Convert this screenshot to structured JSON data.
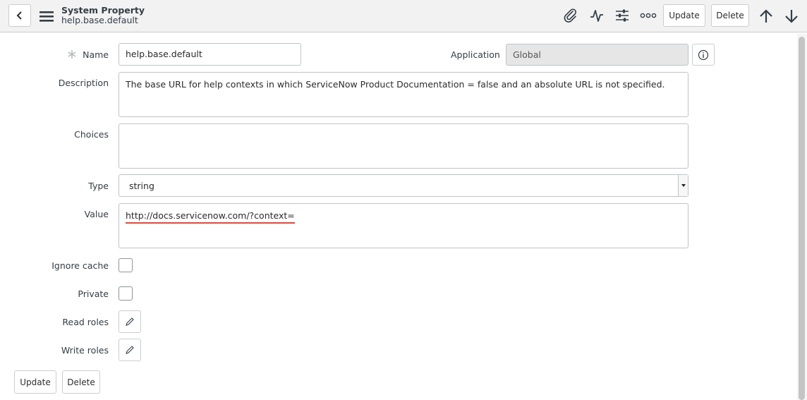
{
  "header": {
    "title": "System Property",
    "subtitle": "help.base.default",
    "update_label": "Update",
    "delete_label": "Delete"
  },
  "form": {
    "name_label": "Name",
    "name_value": "help.base.default",
    "application_label": "Application",
    "application_value": "Global",
    "description_label": "Description",
    "description_value": "The base URL for help contexts in which ServiceNow Product Documentation = false and an absolute URL is not specified.",
    "choices_label": "Choices",
    "choices_value": "",
    "type_label": "Type",
    "type_value": "string",
    "value_label": "Value",
    "value_value": "http://docs.servicenow.com/?context=",
    "ignore_cache_label": "Ignore cache",
    "private_label": "Private",
    "read_roles_label": "Read roles",
    "write_roles_label": "Write roles"
  },
  "footer": {
    "update_label": "Update",
    "delete_label": "Delete"
  },
  "icons": {
    "back": "chevron-left-icon",
    "menu": "hamburger-icon",
    "attach": "paperclip-icon",
    "activity": "activity-icon",
    "personalize": "sliders-icon",
    "more": "more-icon",
    "prev": "arrow-up-icon",
    "next": "arrow-down-icon",
    "info": "info-icon",
    "edit": "pencil-icon",
    "mandatory": "asterisk-icon"
  },
  "colors": {
    "header_bg": "#f2f2f2",
    "readonly_bg": "#e6e6e6",
    "spellcheck_underline": "#e2483b"
  }
}
